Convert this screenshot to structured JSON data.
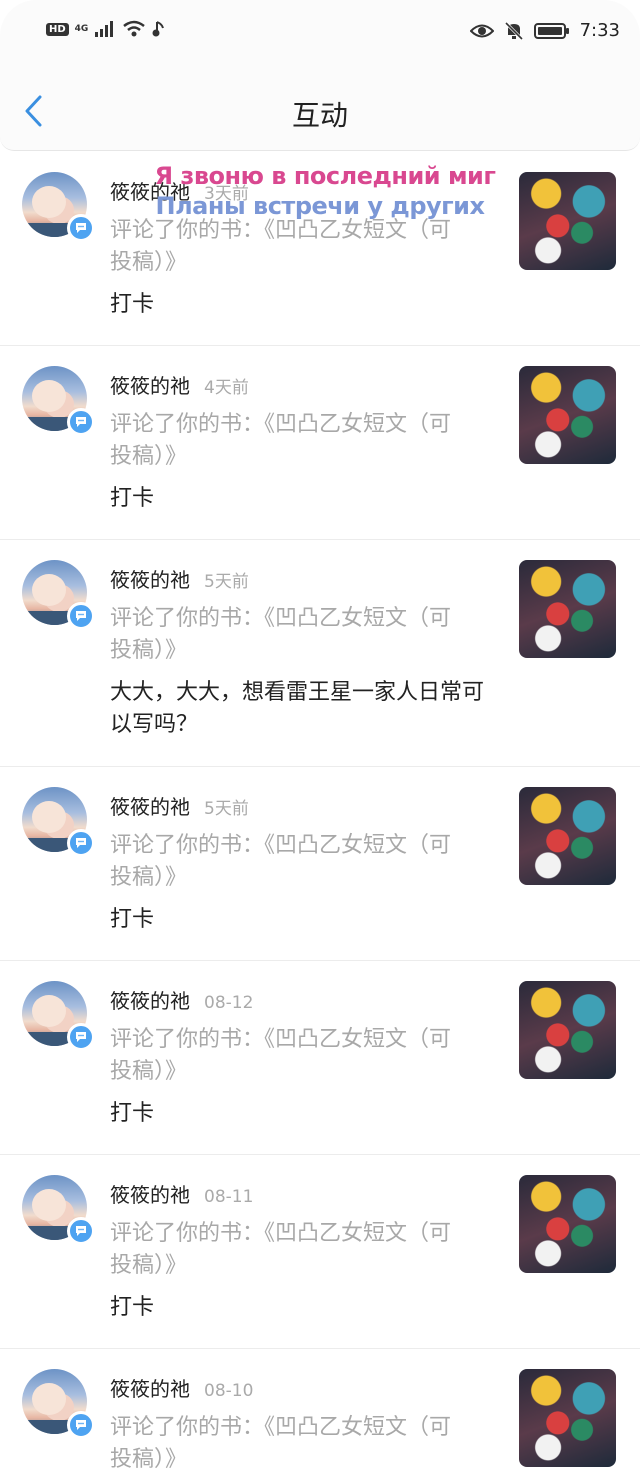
{
  "status_bar": {
    "hd": "HD",
    "signal": "4G",
    "time": "7:33"
  },
  "header": {
    "title": "互动"
  },
  "overlay": {
    "line1": "Я звоню в последний миг",
    "line2": "Планы встречи у других"
  },
  "items": [
    {
      "name": "筱筱的祂",
      "time": "3天前",
      "action": "评论了你的书：《凹凸乙女短文（可投稿）》",
      "comment": "打卡"
    },
    {
      "name": "筱筱的祂",
      "time": "4天前",
      "action": "评论了你的书：《凹凸乙女短文（可投稿）》",
      "comment": "打卡"
    },
    {
      "name": "筱筱的祂",
      "time": "5天前",
      "action": "评论了你的书：《凹凸乙女短文（可投稿）》",
      "comment": "大大，大大，想看雷王星一家人日常可以写吗？"
    },
    {
      "name": "筱筱的祂",
      "time": "5天前",
      "action": "评论了你的书：《凹凸乙女短文（可投稿）》",
      "comment": "打卡"
    },
    {
      "name": "筱筱的祂",
      "time": "08-12",
      "action": "评论了你的书：《凹凸乙女短文（可投稿）》",
      "comment": "打卡"
    },
    {
      "name": "筱筱的祂",
      "time": "08-11",
      "action": "评论了你的书：《凹凸乙女短文（可投稿）》",
      "comment": "打卡"
    },
    {
      "name": "筱筱的祂",
      "time": "08-10",
      "action": "评论了你的书：《凹凸乙女短文（可投稿）》",
      "comment": ""
    }
  ]
}
